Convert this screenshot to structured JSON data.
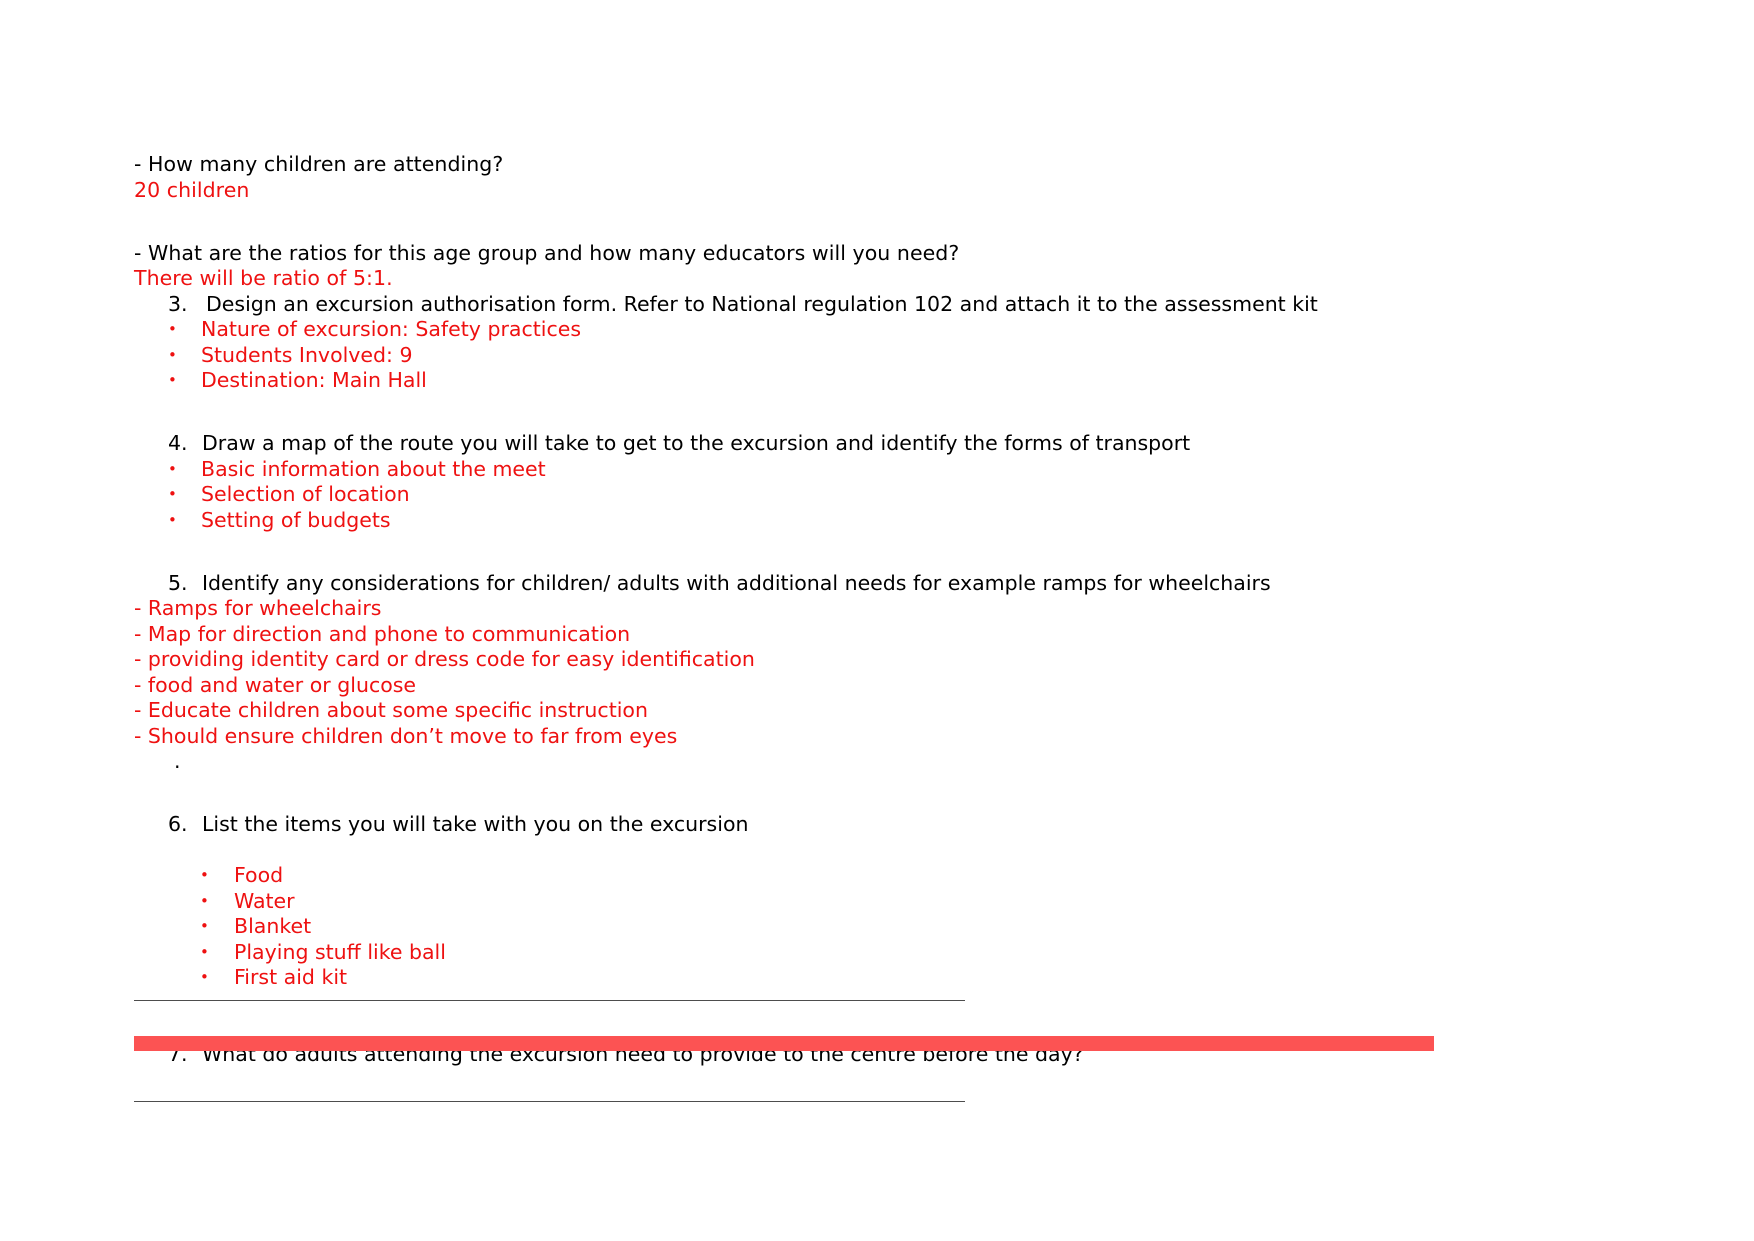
{
  "document": {
    "colors": {
      "answer_red": "#ee1111",
      "question_black": "#000000",
      "footer_bar_red": "#fc5353",
      "footer_rule_gray": "#4d4d4d",
      "page_background": "#ffffff"
    },
    "blocks": [
      {
        "id": "q_children_count",
        "question": "- How many children are attending?",
        "answer": "20 children"
      },
      {
        "id": "q_ratios",
        "question": "- What are the ratios for this age group and how many educators will you need?",
        "answer": "There will be ratio of 5:1."
      }
    ],
    "items": [
      {
        "number": "3.",
        "text": "Design an excursion authorisation form. Refer to National regulation 102 and attach it to the assessment kit",
        "bullets": [
          "Nature of excursion: Safety practices",
          "Students Involved: 9",
          "Destination: Main Hall"
        ]
      },
      {
        "number": "4.",
        "text": "Draw a map of the route you will take to get to the excursion and identify the forms of transport",
        "bullets": [
          "Basic information about the meet",
          "Selection of location",
          "Setting of budgets"
        ]
      },
      {
        "number": "5.",
        "text": "Identify any considerations for children/ adults with additional needs for example ramps for wheelchairs",
        "dash_answers": [
          "- Ramps for wheelchairs",
          "- Map for direction and phone to communication",
          "- providing identity card or dress code for easy identification",
          "- food and water or glucose",
          "- Educate children about some specific instruction",
          "- Should ensure children don’t move to far from eyes"
        ],
        "stray_mark": "."
      },
      {
        "number": "6.",
        "text": "List the items you will take with you on the excursion",
        "bullets": [
          "Food",
          "Water",
          "Blanket",
          "Playing stuff like ball",
          "First aid kit"
        ]
      },
      {
        "number": "7.",
        "text": "What do adults attending the excursion need to provide to the centre before the day?",
        "bullets": []
      }
    ],
    "bullet_glyph": "•",
    "footer": {
      "rule_top": "",
      "rule_bottom": "",
      "accent_bar": ""
    }
  }
}
